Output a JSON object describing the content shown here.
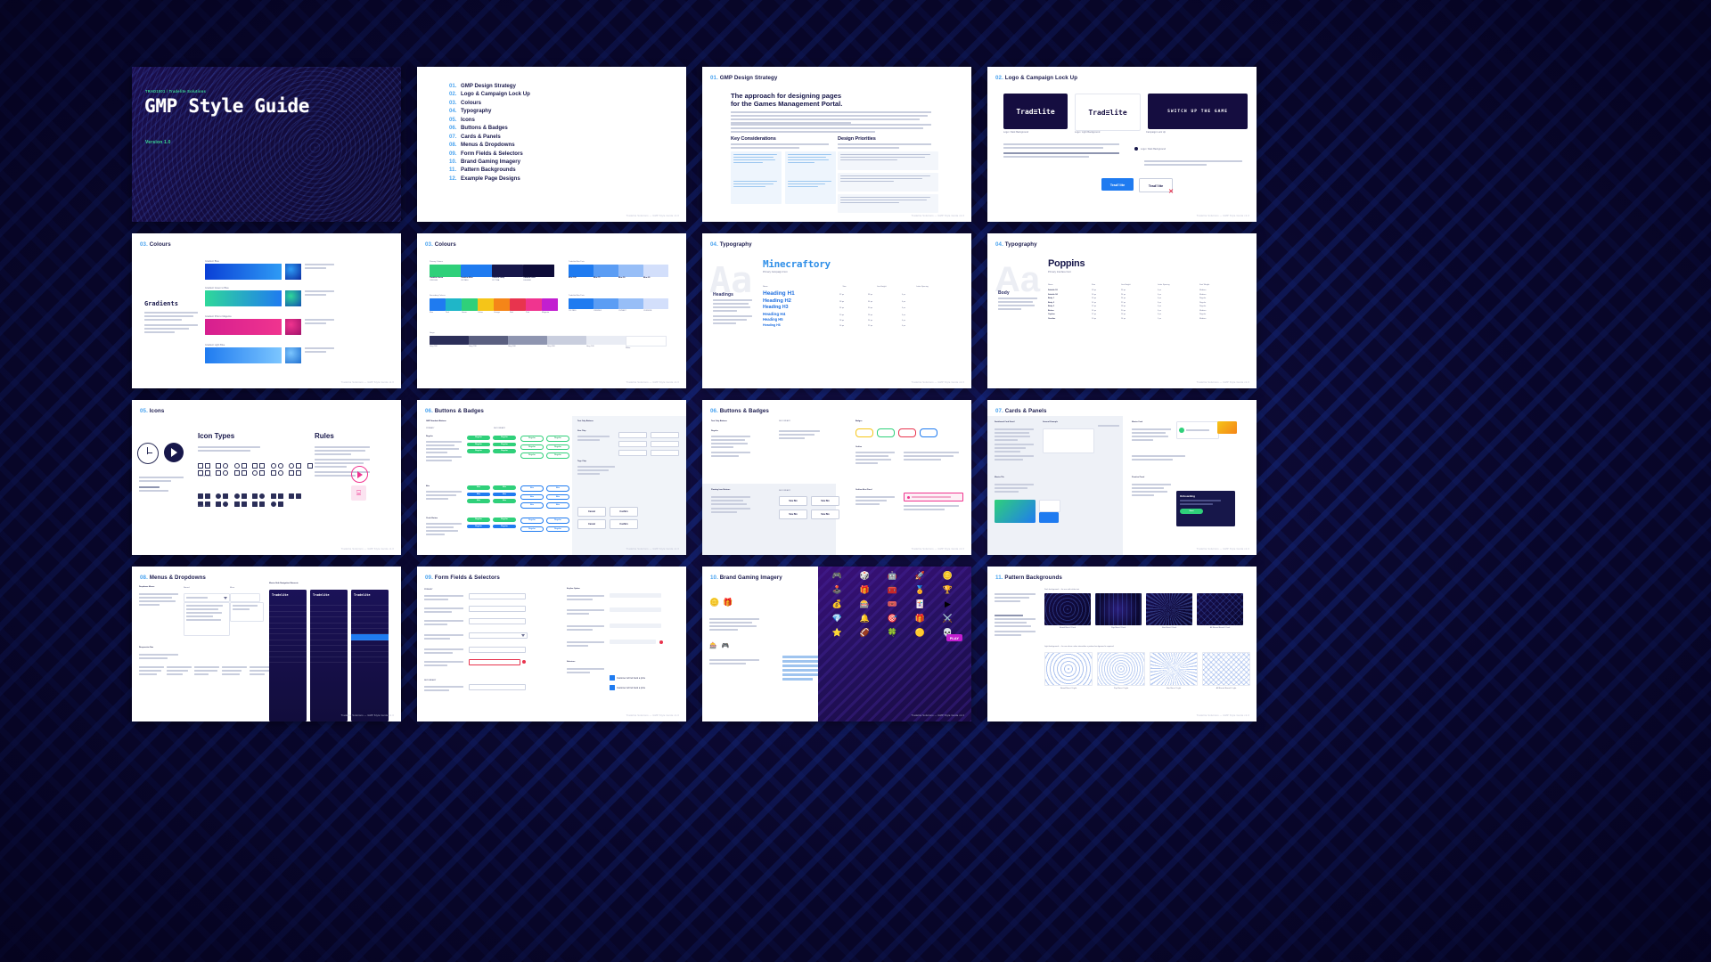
{
  "deck": {
    "cover": {
      "eyebrow": "TRAD1001 / Tradelite Solutions",
      "title": "GMP Style Guide",
      "version": "Version 1.0"
    },
    "footer_note": "Tradelite Solutions — GMP Style Guide v1.0",
    "toc": {
      "items": [
        {
          "num": "01.",
          "label": "GMP Design Strategy"
        },
        {
          "num": "02.",
          "label": "Logo & Campaign Lock Up"
        },
        {
          "num": "03.",
          "label": "Colours"
        },
        {
          "num": "04.",
          "label": "Typography"
        },
        {
          "num": "05.",
          "label": "Icons"
        },
        {
          "num": "06.",
          "label": "Buttons & Badges"
        },
        {
          "num": "07.",
          "label": "Cards & Panels"
        },
        {
          "num": "08.",
          "label": "Menus & Dropdowns"
        },
        {
          "num": "09.",
          "label": "Form Fields & Selectors"
        },
        {
          "num": "10.",
          "label": "Brand Gaming Imagery"
        },
        {
          "num": "11.",
          "label": "Pattern Backgrounds"
        },
        {
          "num": "12.",
          "label": "Example Page Designs"
        }
      ]
    },
    "slides": [
      {
        "num": "01.",
        "title": "GMP Design Strategy"
      },
      {
        "num": "02.",
        "title": "Logo & Campaign Lock Up"
      },
      {
        "num": "03.",
        "title": "Colours"
      },
      {
        "num": "03.",
        "title": "Colours"
      },
      {
        "num": "04.",
        "title": "Typography"
      },
      {
        "num": "04.",
        "title": "Typography"
      },
      {
        "num": "05.",
        "title": "Icons"
      },
      {
        "num": "06.",
        "title": "Buttons & Badges"
      },
      {
        "num": "06.",
        "title": "Buttons & Badges"
      },
      {
        "num": "07.",
        "title": "Cards & Panels"
      },
      {
        "num": "08.",
        "title": "Menus & Dropdowns"
      },
      {
        "num": "09.",
        "title": "Form Fields & Selectors"
      },
      {
        "num": "10.",
        "title": "Brand Gaming Imagery"
      },
      {
        "num": "11.",
        "title": "Pattern Backgrounds"
      }
    ],
    "strategy": {
      "heading_line1": "The approach for designing pages",
      "heading_line2": "for the Games Management Portal.",
      "key_considerations": "Key Considerations",
      "design_priorities": "Design Priorities"
    },
    "logo": {
      "primary": "Trad≡lite",
      "secondary": "Trad≡lite",
      "campaign": "SWITCH UP THE GAME",
      "caption_primary": "Logo / Dark Background",
      "caption_secondary": "Logo / Light Background",
      "caption_campaign": "Campaign Lock Up",
      "btn_primary": "Trad≡lite",
      "btn_secondary": "Trad≡lite"
    },
    "colours": {
      "gradients_title": "Gradients",
      "gradient_labels": [
        "Gradient Blue",
        "Gradient Green to Blue",
        "Gradient Pink to Magenta",
        "Gradient Light Blue"
      ],
      "gradients": [
        {
          "name": "Gradient Blue",
          "from": "#0a3fd6",
          "to": "#2e9bf5"
        },
        {
          "name": "Gradient Green to Blue",
          "from": "#2fd89a",
          "to": "#1f7bf0"
        },
        {
          "name": "Gradient Pink to Magenta",
          "from": "#d61f8f",
          "to": "#f0348f"
        },
        {
          "name": "Gradient Light Blue",
          "from": "#1f7bf0",
          "to": "#7cc6ff"
        }
      ],
      "primary_title": "Primary Colours",
      "primary": [
        {
          "name": "Tradelite Green",
          "hex": "#2FD07A"
        },
        {
          "name": "Tradelite Blue",
          "hex": "#1F7BF0"
        },
        {
          "name": "Tradelite Navy",
          "hex": "#17174A"
        },
        {
          "name": "Tradelite Dark",
          "hex": "#0D0B38"
        }
      ],
      "secondary_title": "Secondary Colours",
      "secondary": [
        {
          "name": "Blue",
          "hex": "#1F7BF0"
        },
        {
          "name": "Teal",
          "hex": "#1FB6C8"
        },
        {
          "name": "Green",
          "hex": "#2FD07A"
        },
        {
          "name": "Yellow",
          "hex": "#F5C518"
        },
        {
          "name": "Orange",
          "hex": "#F58518"
        },
        {
          "name": "Red",
          "hex": "#E8344E"
        },
        {
          "name": "Pink",
          "hex": "#F0348F"
        },
        {
          "name": "Magenta",
          "hex": "#C21FD0"
        }
      ],
      "tints_title": "Tradelite Blue Tints",
      "tints": [
        {
          "name": "Blue 100",
          "hex": "#1F7BF0"
        },
        {
          "name": "Blue 75",
          "hex": "#5B9DF4"
        },
        {
          "name": "Blue 50",
          "hex": "#97BEF7"
        },
        {
          "name": "Blue 25",
          "hex": "#D3DFFB"
        }
      ],
      "grey_title": "Greys",
      "greys": [
        {
          "name": "Grey 900",
          "hex": "#2B2E58"
        },
        {
          "name": "Grey 700",
          "hex": "#5A5F80"
        },
        {
          "name": "Grey 500",
          "hex": "#8E95B0"
        },
        {
          "name": "Grey 300",
          "hex": "#C9CEDE"
        },
        {
          "name": "Grey 100",
          "hex": "#E9ECF4"
        },
        {
          "name": "White",
          "hex": "#FFFFFF"
        }
      ]
    },
    "typography": {
      "display_font": "Minecraftory",
      "display_caption": "Primary Campaign Font",
      "body_font": "Poppins",
      "body_caption": "Primary Interface Font",
      "ghost_display": "Aa",
      "ghost_body": "Aa",
      "headings_label": "Headings",
      "body_label": "Body",
      "table_headers": [
        "Name",
        "Size",
        "Line Height",
        "Letter Spacing"
      ],
      "headings": [
        {
          "name": "Heading H1",
          "size": "32 px",
          "line": "38 px",
          "ls": "0 px"
        },
        {
          "name": "Heading H2",
          "size": "28 px",
          "line": "34 px",
          "ls": "0 px"
        },
        {
          "name": "Heading H3",
          "size": "24 px",
          "line": "30 px",
          "ls": "0 px"
        },
        {
          "name": "Heading H4",
          "size": "20 px",
          "line": "26 px",
          "ls": "0 px"
        },
        {
          "name": "Heading H5",
          "size": "18 px",
          "line": "24 px",
          "ls": "0 px"
        },
        {
          "name": "Heading H6",
          "size": "16 px",
          "line": "22 px",
          "ls": "0 px"
        }
      ],
      "body_table_headers": [
        "Name",
        "Size",
        "Line Height",
        "Letter Spacing",
        "Font Weight"
      ],
      "body_rows": [
        {
          "name": "Subtitle S1",
          "size": "18 px",
          "line": "26 px",
          "ls": "0 px",
          "weight": "Medium"
        },
        {
          "name": "Subtitle S2",
          "size": "16 px",
          "line": "24 px",
          "ls": "0 px",
          "weight": "Medium"
        },
        {
          "name": "Body 1",
          "size": "16 px",
          "line": "24 px",
          "ls": "0 px",
          "weight": "Regular"
        },
        {
          "name": "Body 2",
          "size": "14 px",
          "line": "22 px",
          "ls": "0 px",
          "weight": "Regular"
        },
        {
          "name": "Body 3",
          "size": "12 px",
          "line": "18 px",
          "ls": "0 px",
          "weight": "Regular"
        },
        {
          "name": "Button",
          "size": "14 px",
          "line": "20 px",
          "ls": "0 px",
          "weight": "Medium"
        },
        {
          "name": "Caption",
          "size": "12 px",
          "line": "16 px",
          "ls": "0 px",
          "weight": "Regular"
        },
        {
          "name": "Overline",
          "size": "10 px",
          "line": "14 px",
          "ls": "1 px",
          "weight": "Medium"
        }
      ]
    },
    "icons": {
      "types_title": "Icon Types",
      "rules_title": "Rules",
      "outline_label": "Outline Icons",
      "solid_label": "Solid Icons",
      "play_label": "Play",
      "save_label": "Save"
    },
    "buttons": {
      "primary_label": "PRIMARY",
      "secondary_label": "SECONDARY",
      "regular_label": "Regular",
      "alt_label": "Altn",
      "standard_title": "GMP Standard Buttons",
      "text_only_title": "Text Only Buttons",
      "floating_title": "Floating Icon Buttons",
      "badges_title": "Badges",
      "outline_title": "Outline",
      "alert_title": "Outline Alert Panel",
      "size_title": "Size Chip",
      "tag_title": "Tags Chip",
      "circle_title": "Circle Button",
      "size_btn_label": "Size Btn",
      "cancel_label": "Cancel",
      "confirm_label": "Confirm"
    },
    "cards": {
      "dashboard_title": "Dashboard Card Detail",
      "general_title": "General Example",
      "master_title": "Master Card",
      "hero_title": "Master Tile",
      "practice_title": "Practice Panel",
      "onboarding_label": "Onboarding",
      "cta_label": "Start"
    },
    "menus": {
      "dropdown_title": "Dropdown Menus",
      "responsive_title": "Responsive Nav",
      "side_nav_title": "Master Side Navigation Elements",
      "normal_label": "Normal",
      "micro_label": "Micro",
      "brand": "Trad≡lite"
    },
    "forms": {
      "primary_label": "PRIMARY",
      "secondary_label": "SECONDARY",
      "keyline_label": "Keyline Option",
      "selectors_label": "Selectors",
      "checkbox_1": "Customer will not book a prize",
      "checkbox_2": "Customer will not book a prize",
      "field_placeholder": "Field",
      "select_placeholder": "Select"
    },
    "imagery": {
      "play_badge": "PLAY"
    },
    "patterns": {
      "dark_label": "Dark background — for use with white text",
      "light_label": "Light background — for use when colour intensifies a pattern background is required",
      "dark_tiles": [
        "Brand Burst / Dark",
        "Pop Burst / Dark",
        "Star Burst / Dark",
        "All Round Brand / Dark"
      ],
      "light_tiles": [
        "Brand Burst / Light",
        "Pop Burst / Light",
        "Star Burst / Light",
        "All Round Brand / Light"
      ]
    },
    "colors": {
      "accent_blue": "#1F7BF0",
      "accent_cyan": "#4AA3EF",
      "accent_green": "#3DDC97",
      "navy": "#17174A",
      "deep": "#0D0B38",
      "pink": "#F0348F"
    }
  }
}
